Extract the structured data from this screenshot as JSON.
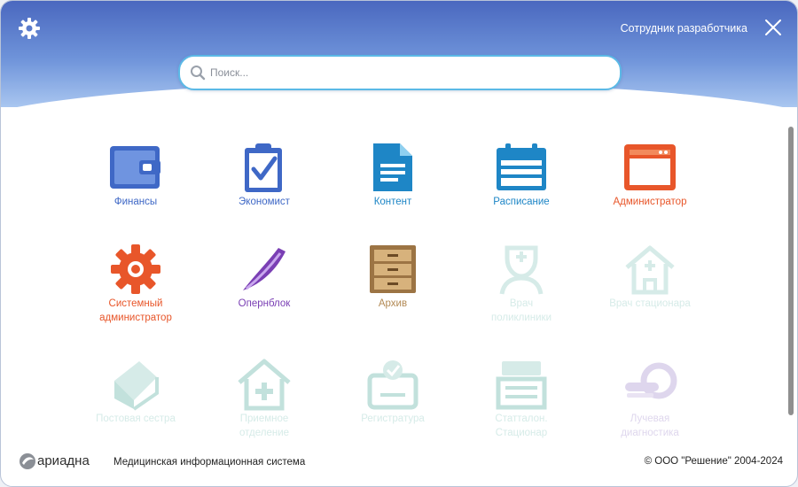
{
  "header": {
    "user_name": "Сотрудник разработчика",
    "settings_icon": "gear-icon",
    "close_icon": "close-icon"
  },
  "search": {
    "placeholder": "Поиск...",
    "value": "",
    "icon": "search-icon"
  },
  "modules": [
    {
      "label": "Финансы",
      "icon": "wallet-icon",
      "color": "#3f68c6",
      "enabled": true
    },
    {
      "label": "Экономист",
      "icon": "clipboard-check-icon",
      "color": "#3f68c6",
      "enabled": true
    },
    {
      "label": "Контент",
      "icon": "document-icon",
      "color": "#1e86c6",
      "enabled": true
    },
    {
      "label": "Расписание",
      "icon": "calendar-icon",
      "color": "#1e86c6",
      "enabled": true
    },
    {
      "label": "Администратор",
      "icon": "browser-window-icon",
      "color": "#e8562a",
      "enabled": true
    },
    {
      "label": "Системный\nадминистратор",
      "icon": "cog-icon",
      "color": "#e8562a",
      "enabled": true
    },
    {
      "label": "Опернблок",
      "icon": "scalpel-icon",
      "color": "#7a3fb4",
      "enabled": true
    },
    {
      "label": "Архив",
      "icon": "cabinet-icon",
      "color": "#b38a55",
      "enabled": true
    },
    {
      "label": "Врач\nполиклиники",
      "icon": "nurse-icon",
      "color": "#cfe8e4",
      "enabled": false
    },
    {
      "label": "Врач стационара",
      "icon": "hospital-home-icon",
      "color": "#cfe8e4",
      "enabled": false
    },
    {
      "label": "Постовая сестра",
      "icon": "bed-icon",
      "color": "#cfe8e4",
      "enabled": false
    },
    {
      "label": "Приемное\nотделение",
      "icon": "house-plus-icon",
      "color": "#cfe8e4",
      "enabled": false
    },
    {
      "label": "Регистратура",
      "icon": "registry-icon",
      "color": "#cfe8e4",
      "enabled": false
    },
    {
      "label": "Статталон.\nСтационар",
      "icon": "tray-icon",
      "color": "#cfe8e4",
      "enabled": false
    },
    {
      "label": "Лучевая\nдиагностика",
      "icon": "mri-scanner-icon",
      "color": "#d9d0ea",
      "enabled": false
    }
  ],
  "footer": {
    "logo_text": "ариадна",
    "system_name": "Медицинская информационная система",
    "copyright": "© ООО \"Решение\" 2004-2024"
  }
}
